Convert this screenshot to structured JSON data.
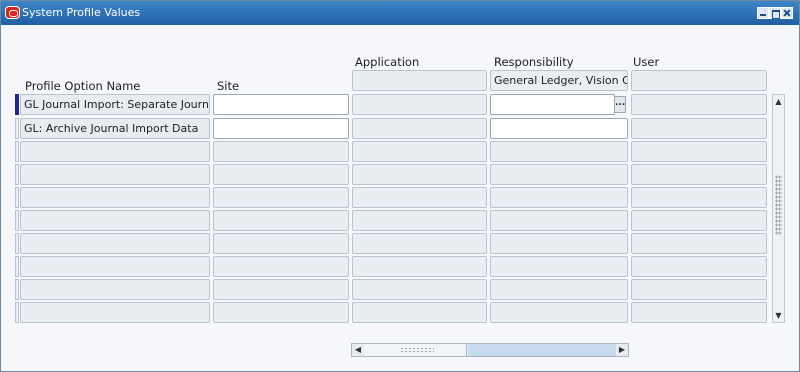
{
  "window": {
    "title": "System Profile Values"
  },
  "columns": {
    "profile_option_name": "Profile Option Name",
    "site": "Site",
    "application": "Application",
    "responsibility": "Responsibility",
    "user": "User"
  },
  "context": {
    "responsibility_value": "General Ledger, Vision Opera"
  },
  "rows": [
    {
      "name": "GL Journal Import: Separate Journals by",
      "site": "",
      "application": "",
      "responsibility": "",
      "user": ""
    },
    {
      "name": "GL: Archive Journal Import Data",
      "site": "",
      "application": "",
      "responsibility": "",
      "user": ""
    }
  ],
  "lov_button": "...",
  "icons": {
    "logo": "oracle-logo-icon",
    "minimize": "minimize-icon",
    "maximize": "maximize-icon",
    "close": "close-icon",
    "up": "scroll-up-icon",
    "down": "scroll-down-icon",
    "left": "scroll-left-icon",
    "right": "scroll-right-icon"
  },
  "colors": {
    "title_bar": "#1f5fa4",
    "active_row_indicator": "#1d2a8a"
  }
}
